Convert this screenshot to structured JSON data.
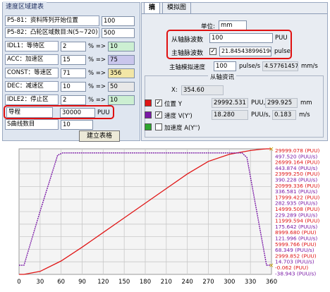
{
  "left_panel": {
    "title": "速度区域建表",
    "rows": [
      {
        "label": "P5-81：资料阵列开始位置",
        "value": "100"
      },
      {
        "label": "P5-82：凸轮区域数目:N(5~720)",
        "value": "500"
      },
      {
        "label": "IDL1：等待区",
        "value": "2",
        "arrow": "% =>",
        "result": "10"
      },
      {
        "label": "ACC：加速区",
        "value": "15",
        "arrow": "% =>",
        "result": "75"
      },
      {
        "label": "CONST：等速区",
        "value": "71",
        "arrow": "% =>",
        "result": "356"
      },
      {
        "label": "DEC：减速区",
        "value": "10",
        "arrow": "% =>",
        "result": "50"
      },
      {
        "label": "IDLE2：停止区",
        "value": "2",
        "arrow": "% =>",
        "result": "10"
      }
    ],
    "lead": {
      "label": "导程",
      "value": "30000",
      "unit": "PUU"
    },
    "s_curve": {
      "label": "S曲线数目",
      "value": "10"
    },
    "build_button": "建立表格"
  },
  "right_panel": {
    "tabs": [
      "摘",
      "模拟图"
    ],
    "unit_label": "单位:",
    "unit_value": "mm",
    "slave_pulse": {
      "label": "从轴脉波数",
      "value": "100",
      "unit": "PUU"
    },
    "master_pulse": {
      "label": "主轴脉波数",
      "checked": true,
      "value": "21.845438996196(",
      "unit": "pulse"
    },
    "master_speed": {
      "label": "主轴模拟速度",
      "value": "100",
      "unit": "pulse/s",
      "value2": "4.577614577",
      "unit2": "mm/s"
    },
    "slave_info": {
      "title": "从轴资讯",
      "x_label": "X:",
      "x_value": "354.60",
      "position": {
        "color": "#e01515",
        "checked": true,
        "label": "位置 Y",
        "value": "29992.531",
        "unit": "PUU,",
        "value2": "299.925",
        "unit2": "mm"
      },
      "velocity": {
        "color": "#7a1aa6",
        "checked": true,
        "label": "速度 V(Y')",
        "value": "18.280",
        "unit": "PUU/s,",
        "value2": "0.183",
        "unit2": "m/s"
      },
      "accel": {
        "color": "#2ea52e",
        "checked": false,
        "label": "加速度 A(Y'')"
      }
    }
  },
  "chart_data": {
    "type": "line",
    "x_ticks": [
      "0",
      "30",
      "60",
      "90",
      "120",
      "150",
      "180",
      "210",
      "240",
      "270",
      "300",
      "330",
      "360"
    ],
    "xlim": [
      0,
      360
    ],
    "grid": true,
    "right_axis_labels": [
      {
        "text": "29999.078 (PUU)",
        "color": "#e01515"
      },
      {
        "text": "497.520 (PUU/s)",
        "color": "#7a1aa6"
      },
      {
        "text": "26999.164 (PUU)",
        "color": "#e01515"
      },
      {
        "text": "443.874 (PUU/s)",
        "color": "#7a1aa6"
      },
      {
        "text": "23999.250 (PUU)",
        "color": "#e01515"
      },
      {
        "text": "390.228 (PUU/s)",
        "color": "#7a1aa6"
      },
      {
        "text": "20999.336 (PUU)",
        "color": "#e01515"
      },
      {
        "text": "336.581 (PUU/s)",
        "color": "#7a1aa6"
      },
      {
        "text": "17999.422 (PUU)",
        "color": "#e01515"
      },
      {
        "text": "282.935 (PUU/s)",
        "color": "#7a1aa6"
      },
      {
        "text": "14999.508 (PUU)",
        "color": "#e01515"
      },
      {
        "text": "229.289 (PUU/s)",
        "color": "#7a1aa6"
      },
      {
        "text": "11999.594 (PUU)",
        "color": "#e01515"
      },
      {
        "text": "175.642 (PUU/s)",
        "color": "#7a1aa6"
      },
      {
        "text": "8999.680 (PUU)",
        "color": "#e01515"
      },
      {
        "text": "121.996 (PUU/s)",
        "color": "#7a1aa6"
      },
      {
        "text": "5999.766 (PUU)",
        "color": "#e01515"
      },
      {
        "text": "68.349 (PUU/s)",
        "color": "#7a1aa6"
      },
      {
        "text": "2999.852 (PUU)",
        "color": "#e01515"
      },
      {
        "text": "14.703 (PUU/s)",
        "color": "#7a1aa6"
      },
      {
        "text": "-0.062 (PUU)",
        "color": "#e01515"
      },
      {
        "text": "-38.943 (PUU/s)",
        "color": "#7a1aa6"
      }
    ],
    "series": [
      {
        "name": "位置 Y",
        "color": "#e01515",
        "x": [
          0,
          7,
          30,
          60,
          90,
          120,
          150,
          180,
          210,
          240,
          270,
          300,
          330,
          345,
          353,
          360
        ],
        "y": [
          0,
          0,
          700,
          3200,
          6500,
          10000,
          13500,
          17000,
          20500,
          24000,
          27000,
          28700,
          29600,
          29900,
          30000,
          30000
        ]
      },
      {
        "name": "速度 V(Y')",
        "color": "#7a1aa6",
        "x": [
          0,
          7,
          30,
          55,
          62,
          90,
          120,
          150,
          180,
          210,
          240,
          270,
          300,
          318,
          325,
          353,
          360
        ],
        "y": [
          0,
          0,
          230,
          470,
          480,
          480,
          480,
          480,
          480,
          480,
          480,
          480,
          480,
          480,
          460,
          0,
          0
        ]
      }
    ],
    "y_ranges": {
      "position": [
        -0.062,
        29999.078
      ],
      "velocity": [
        -38.943,
        497.52
      ]
    }
  }
}
